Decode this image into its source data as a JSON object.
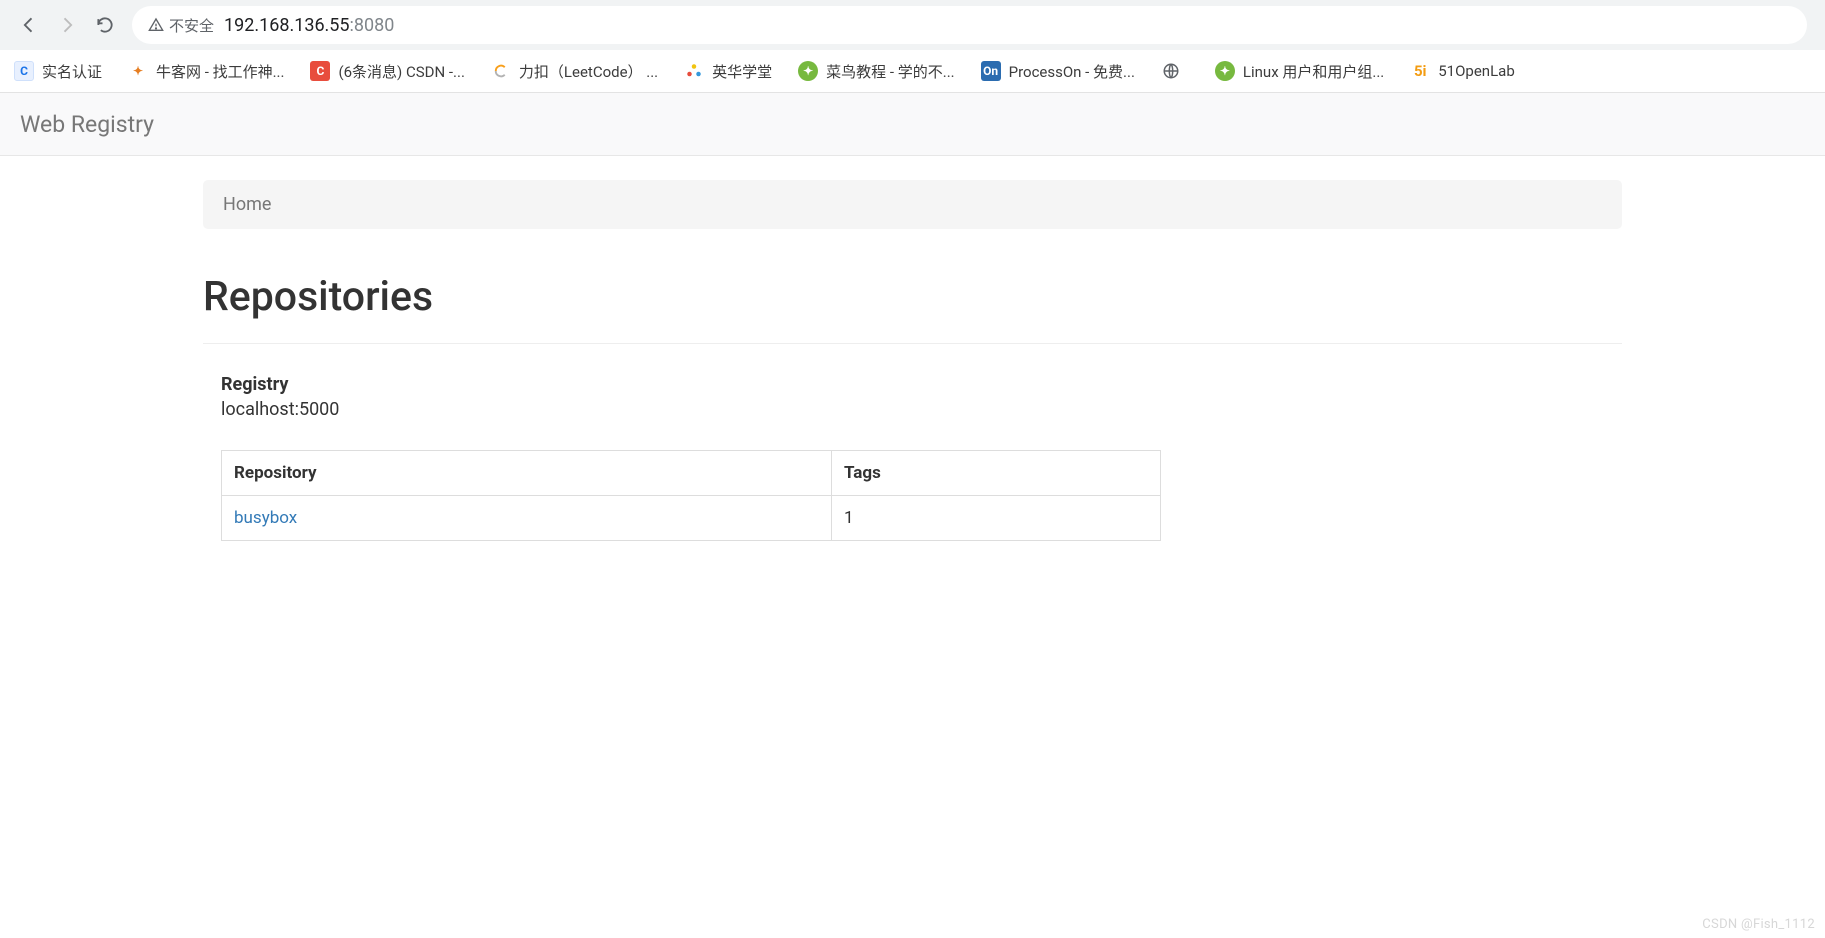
{
  "browser": {
    "security_label": "不安全",
    "url_host": "192.168.136.55",
    "url_port": ":8080"
  },
  "bookmarks": [
    {
      "label": "实名认证"
    },
    {
      "label": "牛客网 - 找工作神..."
    },
    {
      "label": "(6条消息) CSDN -..."
    },
    {
      "label": "力扣（LeetCode） ..."
    },
    {
      "label": "英华学堂"
    },
    {
      "label": "菜鸟教程 - 学的不..."
    },
    {
      "label": "ProcessOn - 免费..."
    },
    {
      "label": ""
    },
    {
      "label": "Linux 用户和用户组..."
    },
    {
      "label": "51OpenLab"
    }
  ],
  "app": {
    "brand": "Web Registry",
    "breadcrumb": "Home",
    "page_title": "Repositories",
    "registry_label": "Registry",
    "registry_value": "localhost:5000",
    "table": {
      "col_repository": "Repository",
      "col_tags": "Tags",
      "rows": [
        {
          "repository": "busybox",
          "tags": "1"
        }
      ]
    }
  },
  "watermark": "CSDN @Fish_1112"
}
